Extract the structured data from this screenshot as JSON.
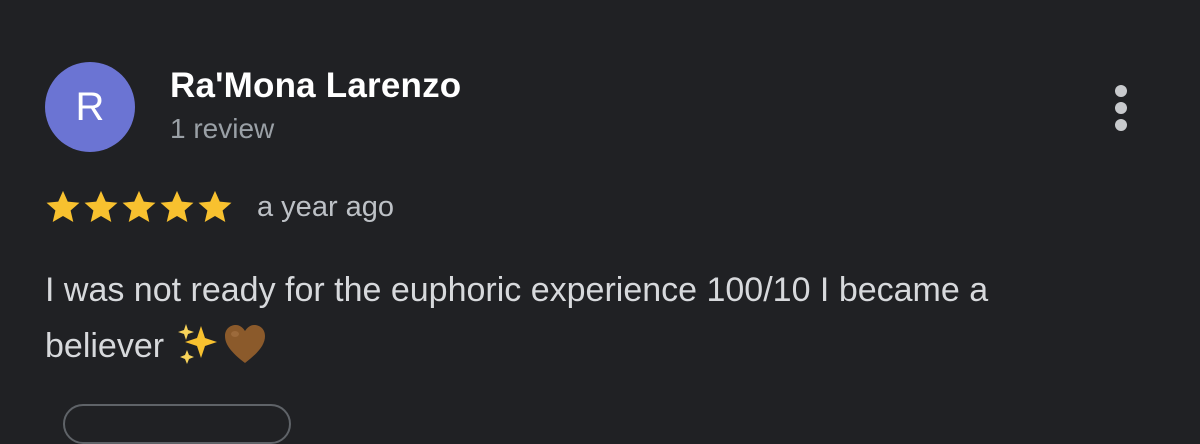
{
  "review": {
    "avatar_initial": "R",
    "reviewer_name": "Ra'Mona Larenzo",
    "review_count": "1 review",
    "rating": 5,
    "rating_max": 5,
    "date": "a year ago",
    "text_line1": "I was not ready for the euphoric experience 100/10 I became a",
    "text_line2": "believer",
    "emojis": [
      "sparkles-icon",
      "brown-heart-icon"
    ]
  },
  "menu": {
    "icon": "more-vert-icon"
  },
  "colors": {
    "background": "#202124",
    "avatar": "#6b74d3",
    "star": "#f8c12f",
    "name": "#ffffff",
    "secondary_text": "#9aa0a6",
    "body_text": "#d7d9dc",
    "heart": "#8b5a2b"
  }
}
